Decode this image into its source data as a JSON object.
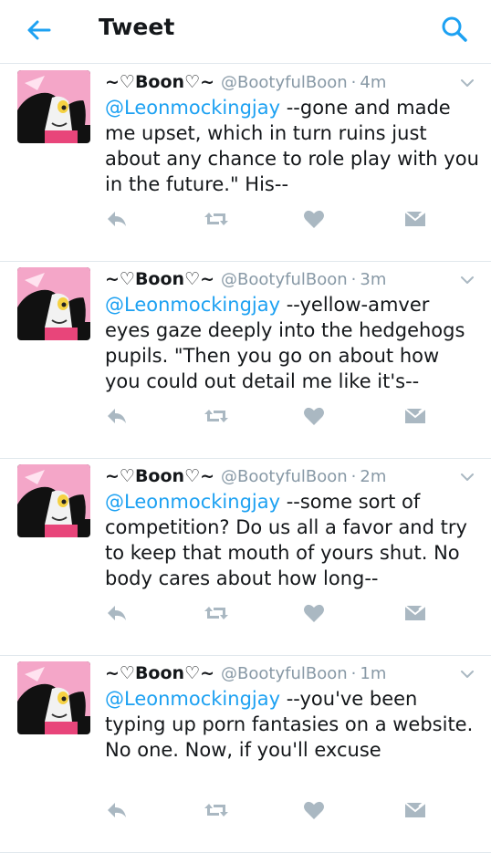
{
  "header": {
    "title": "Tweet",
    "back_icon": "arrow-left-icon",
    "search_icon": "search-icon"
  },
  "colors": {
    "accent": "#1da1f2",
    "muted": "#8899a6",
    "icon": "#aab8c2",
    "divider": "#e1e8ed"
  },
  "tweets": [
    {
      "name": "~♡Boon♡~",
      "handle": "@BootyfulBoon",
      "separator": "·",
      "time": "4m",
      "mention": "@Leonmockingjay",
      "text": " --gone and made me upset, which in turn ruins just about any chance to role play with you in the future.\" His--"
    },
    {
      "name": "~♡Boon♡~",
      "handle": "@BootyfulBoon",
      "separator": "·",
      "time": "3m",
      "mention": "@Leonmockingjay",
      "text": " --yellow-amver eyes gaze deeply into the hedgehogs pupils. \"Then you go on about how you could out detail me like it's--"
    },
    {
      "name": "~♡Boon♡~",
      "handle": "@BootyfulBoon",
      "separator": "·",
      "time": "2m",
      "mention": "@Leonmockingjay",
      "text": " --some sort of competition? Do us all a favor and try to keep that mouth of yours shut. No body cares about how long--"
    },
    {
      "name": "~♡Boon♡~",
      "handle": "@BootyfulBoon",
      "separator": "·",
      "time": "1m",
      "mention": "@Leonmockingjay",
      "text": " --you've been typing up porn fantasies on a website. No one. Now, if you'll excuse"
    }
  ],
  "action_icons": [
    "reply-icon",
    "retweet-icon",
    "like-icon",
    "direct-message-icon"
  ]
}
